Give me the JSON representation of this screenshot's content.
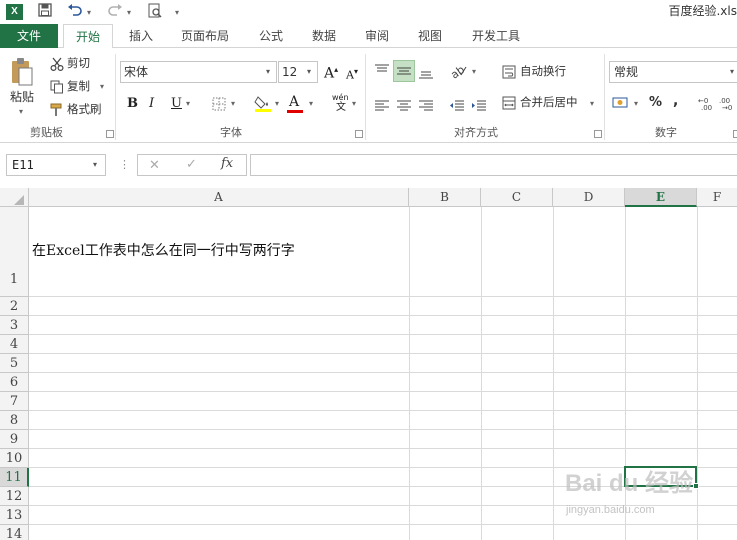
{
  "window": {
    "file_name": "百度经验.xls",
    "app_icon_letter": "X"
  },
  "tabs": [
    {
      "label": "文件"
    },
    {
      "label": "开始"
    },
    {
      "label": "插入"
    },
    {
      "label": "页面布局"
    },
    {
      "label": "公式"
    },
    {
      "label": "数据"
    },
    {
      "label": "审阅"
    },
    {
      "label": "视图"
    },
    {
      "label": "开发工具"
    }
  ],
  "ribbon": {
    "clipboard": {
      "paste": "粘贴",
      "cut": "剪切",
      "copy": "复制",
      "format_painter": "格式刷",
      "group_label": "剪贴板"
    },
    "font": {
      "font_name": "宋体",
      "font_size": "12",
      "grow": "A",
      "shrink": "A",
      "bold": "B",
      "italic": "I",
      "underline": "U",
      "font_color_letter": "A",
      "phonetic": "wén",
      "phonetic_sub": "文",
      "group_label": "字体"
    },
    "alignment": {
      "wrap_text": "自动换行",
      "merge_center": "合并后居中",
      "group_label": "对齐方式"
    },
    "number": {
      "format": "常规",
      "percent": "%",
      "comma": ",",
      "group_label": "数字"
    }
  },
  "formula_bar": {
    "name_box": "E11",
    "fx": "fx",
    "cancel": "✕",
    "confirm": "✓",
    "content": ""
  },
  "sheet": {
    "columns": [
      "A",
      "B",
      "C",
      "D",
      "E",
      "F"
    ],
    "rows": [
      "1",
      "2",
      "3",
      "4",
      "5",
      "6",
      "7",
      "8",
      "9",
      "10",
      "11",
      "12",
      "13",
      "14"
    ],
    "selected_column": "E",
    "selected_row": "11",
    "cells": {
      "A1": "在Excel工作表中怎么在同一行中写两行字"
    }
  },
  "watermark": {
    "brand": "Bai du 经验",
    "url": "jingyan.baidu.com"
  }
}
